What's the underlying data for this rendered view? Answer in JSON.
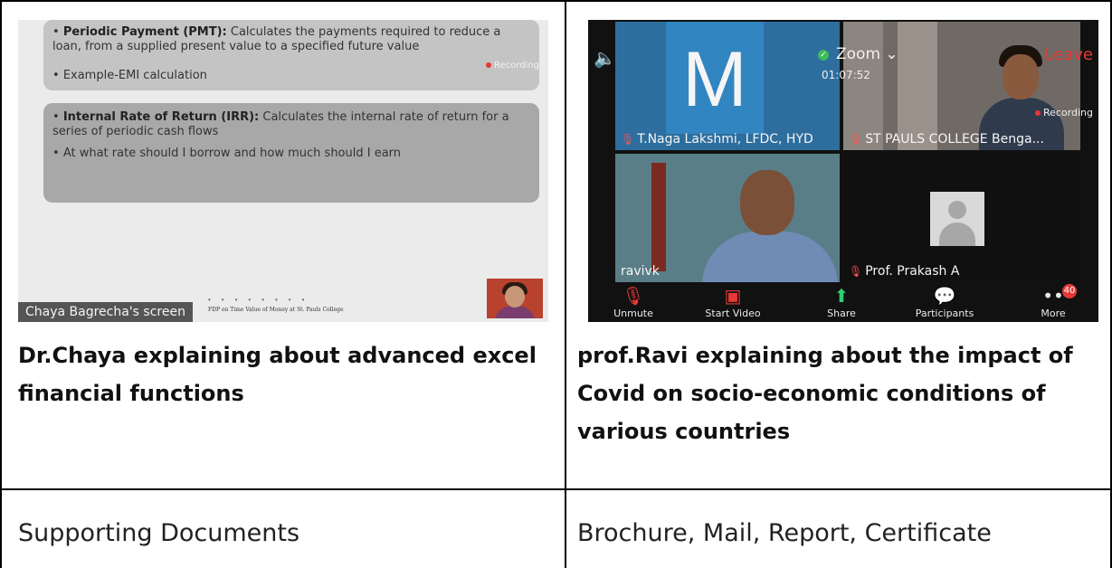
{
  "left_cell": {
    "slide": {
      "bullet1_bold": "Periodic Payment (PMT):",
      "bullet1_text": " Calculates the payments required to reduce a loan, from a supplied present value to a specified future value",
      "bullet2": "Example-EMI calculation",
      "bullet3_bold": "Internal Rate of Return (IRR):",
      "bullet3_text": " Calculates the internal rate of return for a series of periodic cash flows",
      "bullet4": "At what rate should I borrow and how much should I earn",
      "recording": "Recording",
      "screen_label": "Chaya Bagrecha's screen",
      "footer": "FDP on Time Value of Money at St. Pauls College"
    },
    "caption_line1": "Dr.Chaya explaining about advanced excel",
    "caption_line2": "financial functions"
  },
  "right_cell": {
    "zoom": {
      "title": "Zoom",
      "timer": "01:07:52",
      "leave": "Leave",
      "recording": "Recording",
      "tiles": {
        "t1_letter": "M",
        "t1_name": "T.Naga Lakshmi, LFDC, HYD",
        "t2_name": "ST PAULS COLLEGE Benga...",
        "t3_name": "ravivk",
        "t4_name": "Prof. Prakash A"
      },
      "toolbar": {
        "unmute": "Unmute",
        "start_video": "Start Video",
        "share": "Share",
        "participants": "Participants",
        "more": "More",
        "participant_count": "40"
      }
    },
    "caption_line1": "prof.Ravi explaining about the impact of",
    "caption_line2": "Covid on socio-economic conditions of",
    "caption_line3": "various countries"
  },
  "row2": {
    "label": "Supporting Documents",
    "value": "Brochure, Mail, Report, Certificate"
  }
}
